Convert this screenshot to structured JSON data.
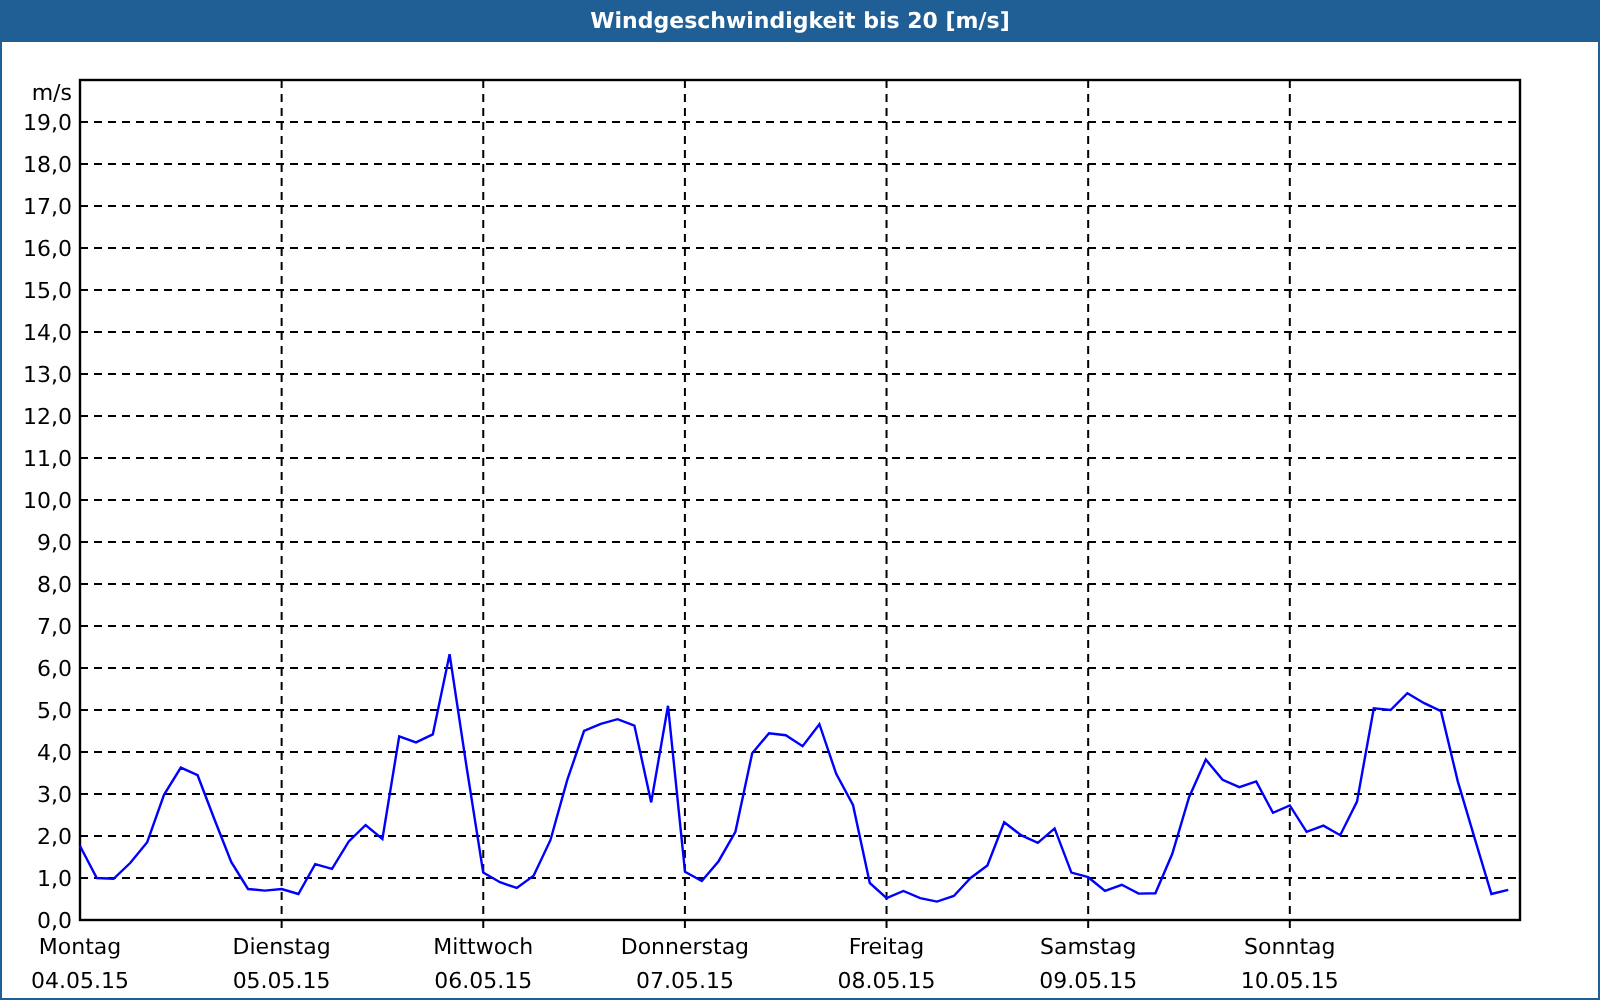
{
  "window": {
    "title": "Windgeschwindigkeit bis 20 [m/s]"
  },
  "chart_data": {
    "type": "line",
    "grid": true,
    "ylabel": "m/s",
    "ylim": [
      0,
      20
    ],
    "categories": [
      "Montag\n04.05.15",
      null,
      null,
      null,
      null,
      null,
      null,
      null,
      null,
      null,
      null,
      null,
      "Dienstag\n05.05.15",
      null,
      null,
      null,
      null,
      null,
      null,
      null,
      null,
      null,
      null,
      null,
      "Mittwoch\n06.05.15",
      null,
      null,
      null,
      null,
      null,
      null,
      null,
      null,
      null,
      null,
      null,
      "Donnerstag\n07.05.15",
      null,
      null,
      null,
      null,
      null,
      null,
      null,
      null,
      null,
      null,
      null,
      "Freitag\n08.05.15",
      null,
      null,
      null,
      null,
      null,
      null,
      null,
      null,
      null,
      null,
      null,
      "Samstag\n09.05.15",
      null,
      null,
      null,
      null,
      null,
      null,
      null,
      null,
      null,
      null,
      null,
      "Sonntag\n10.05.15",
      null,
      null,
      null,
      null,
      null,
      null,
      null,
      null,
      null,
      null,
      null,
      null,
      null
    ],
    "yticks": [
      {
        "value": 0,
        "label": "0,0"
      },
      {
        "value": 1,
        "label": "1,0"
      },
      {
        "value": 2,
        "label": "2,0"
      },
      {
        "value": 3,
        "label": "3,0"
      },
      {
        "value": 4,
        "label": "4,0"
      },
      {
        "value": 5,
        "label": "5,0"
      },
      {
        "value": 6,
        "label": "6,0"
      },
      {
        "value": 7,
        "label": "7,0"
      },
      {
        "value": 8,
        "label": "8,0"
      },
      {
        "value": 9,
        "label": "9,0"
      },
      {
        "value": 10,
        "label": "10,0"
      },
      {
        "value": 11,
        "label": "11,0"
      },
      {
        "value": 12,
        "label": "12,0"
      },
      {
        "value": 13,
        "label": "13,0"
      },
      {
        "value": 14,
        "label": "14,0"
      },
      {
        "value": 15,
        "label": "15,0"
      },
      {
        "value": 16,
        "label": "16,0"
      },
      {
        "value": 17,
        "label": "17,0"
      },
      {
        "value": 18,
        "label": "18,0"
      },
      {
        "value": 19,
        "label": "19,0"
      }
    ],
    "series": [
      {
        "color": "#0000ff",
        "values": [
          1.76,
          1.0,
          0.98,
          1.36,
          1.85,
          2.98,
          3.63,
          3.45,
          2.4,
          1.38,
          0.74,
          0.7,
          0.74,
          0.62,
          1.33,
          1.22,
          1.87,
          2.26,
          1.93,
          4.37,
          4.23,
          4.42,
          6.33,
          3.67,
          1.13,
          0.9,
          0.76,
          1.05,
          1.9,
          3.33,
          4.5,
          4.67,
          4.78,
          4.63,
          2.8,
          5.1,
          1.15,
          0.93,
          1.4,
          2.1,
          3.97,
          4.45,
          4.4,
          4.14,
          4.66,
          3.48,
          2.74,
          0.88,
          0.52,
          0.69,
          0.52,
          0.44,
          0.57,
          1.0,
          1.3,
          2.33,
          2.02,
          1.84,
          2.18,
          1.13,
          1.02,
          0.69,
          0.84,
          0.63,
          0.64,
          1.57,
          2.92,
          3.82,
          3.34,
          3.16,
          3.3,
          2.55,
          2.73,
          2.1,
          2.25,
          2.02,
          2.82,
          5.04,
          5.0,
          5.4,
          5.16,
          4.97,
          3.3,
          1.95,
          0.62,
          0.72
        ]
      }
    ]
  }
}
